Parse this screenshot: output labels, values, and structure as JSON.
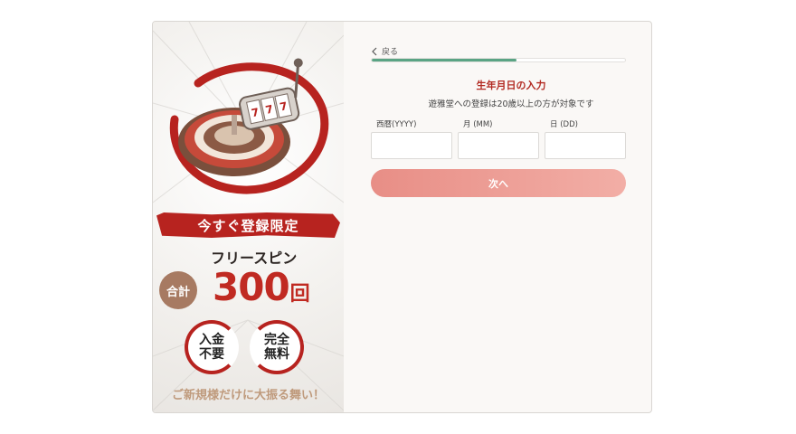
{
  "promo": {
    "banner": "今すぐ登録限定",
    "freespin_label": "フリースピン",
    "total_label": "合計",
    "spin_count": "300",
    "spin_unit": "回",
    "badge_deposit": [
      "入金",
      "不要"
    ],
    "badge_free": [
      "完全",
      "無料"
    ],
    "tagline": "ご新規様だけに大振る舞い！"
  },
  "form": {
    "back_label": "戻る",
    "progress_fraction": 0.57,
    "title": "生年月日の入力",
    "subtitle": "遊雅堂への登録は20歳以上の方が対象です",
    "fields": {
      "year_label": "西暦(YYYY)",
      "month_label": "月 (MM)",
      "day_label": "日 (DD)",
      "year_value": "",
      "month_value": "",
      "day_value": ""
    },
    "next_label": "次へ"
  },
  "colors": {
    "brand_red": "#b7231f",
    "progress_green": "#5aa484",
    "button_pink": "#ee9f97",
    "total_brown": "#a77a62",
    "tagline_tan": "#bf9a7c"
  },
  "icons": {
    "back": "chevron-left-icon",
    "artwork": "roulette-slot-icon"
  }
}
